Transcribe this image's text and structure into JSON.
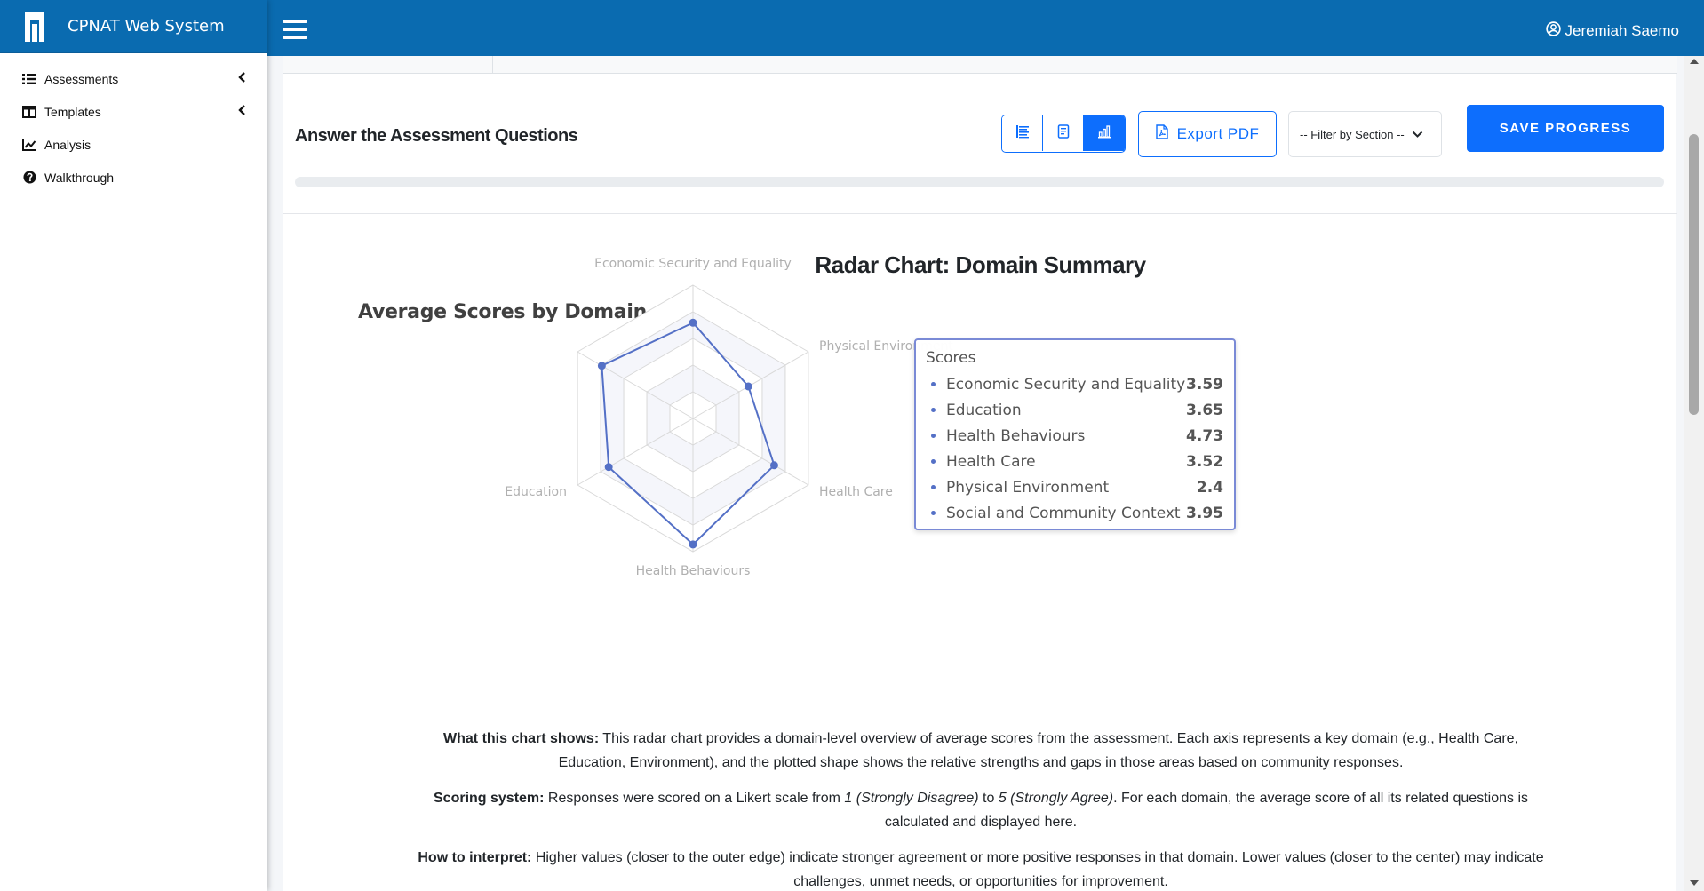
{
  "app": {
    "title": "CPNAT Web System",
    "user_name": "Jeremiah Saemo"
  },
  "sidebar": {
    "items": [
      {
        "label": "Assessments",
        "icon": "list-icon",
        "has_submenu": true
      },
      {
        "label": "Templates",
        "icon": "table-icon",
        "has_submenu": true
      },
      {
        "label": "Analysis",
        "icon": "line-chart-icon",
        "has_submenu": false
      },
      {
        "label": "Walkthrough",
        "icon": "question-circle-icon",
        "has_submenu": false
      }
    ]
  },
  "toolbar": {
    "section_title": "Answer the Assessment Questions",
    "view_modes": [
      "list-view-icon",
      "form-view-icon",
      "chart-view-icon"
    ],
    "active_view": "chart-view-icon",
    "export_label": "Export PDF",
    "filter_label": "-- Filter by Section --",
    "save_label": "SAVE PROGRESS",
    "progress_fraction": 0
  },
  "chart_section": {
    "heading": "Radar Chart: Domain Summary"
  },
  "chart_data": {
    "type": "radar",
    "title": "Average Scores by Domain",
    "axes": [
      "Economic Security and Equality",
      "Physical Environment",
      "Health Care",
      "Health Behaviours",
      "Education",
      "Social and Community Context"
    ],
    "visible_axis_labels": [
      "Economic Security and Equality",
      "Physical Environment",
      "Health Care",
      "Health Behaviours",
      "Education"
    ],
    "max": 5,
    "series": [
      {
        "name": "Scores",
        "values": {
          "Economic Security and Equality": 3.59,
          "Education": 3.65,
          "Health Behaviours": 4.73,
          "Health Care": 3.52,
          "Physical Environment": 2.4,
          "Social and Community Context": 3.95
        }
      }
    ],
    "color": "#5470c6",
    "tooltip": {
      "title": "Scores",
      "rows": [
        {
          "name": "Economic Security and Equality",
          "value": "3.59"
        },
        {
          "name": "Education",
          "value": "3.65"
        },
        {
          "name": "Health Behaviours",
          "value": "4.73"
        },
        {
          "name": "Health Care",
          "value": "3.52"
        },
        {
          "name": "Physical Environment",
          "value": "2.4"
        },
        {
          "name": "Social and Community Context",
          "value": "3.95"
        }
      ]
    }
  },
  "description": {
    "what_label": "What this chart shows:",
    "what_text": " This radar chart provides a domain-level overview of average scores from the assessment. Each axis represents a key domain (e.g., Health Care, Education, Environment), and the plotted shape shows the relative strengths and gaps in those areas based on community responses.",
    "scoring_label": "Scoring system:",
    "scoring_text_1": " Responses were scored on a Likert scale from ",
    "scoring_em_1": "1 (Strongly Disagree)",
    "scoring_text_2": " to ",
    "scoring_em_2": "5 (Strongly Agree)",
    "scoring_text_3": ". For each domain, the average score of all its related questions is calculated and displayed here.",
    "interpret_label": "How to interpret:",
    "interpret_text": " Higher values (closer to the outer edge) indicate stronger agreement or more positive responses in that domain. Lower values (closer to the center) may indicate challenges, unmet needs, or opportunities for improvement."
  }
}
